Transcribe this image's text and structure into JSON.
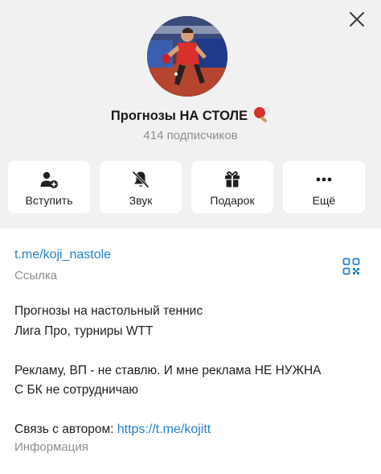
{
  "channel": {
    "title": "Прогнозы НА СТОЛЕ",
    "title_emoji": "🏓",
    "subscribers": "414 подписчиков"
  },
  "actions": [
    {
      "label": "Вступить",
      "icon": "add-user-icon"
    },
    {
      "label": "Звук",
      "icon": "bell-muted-icon"
    },
    {
      "label": "Подарок",
      "icon": "gift-icon"
    },
    {
      "label": "Ещё",
      "icon": "more-icon"
    }
  ],
  "link": {
    "value": "t.me/koji_nastole",
    "label": "Ссылка"
  },
  "description": {
    "line1": "Прогнозы на настольный теннис",
    "line2": "Лига Про, турниры WTT",
    "line3": "Рекламу, ВП - не ставлю. И мне реклама НЕ НУЖНА",
    "line4": "С БК не сотрудничаю",
    "contact_prefix": "Связь с автором: ",
    "contact_link": "https://t.me/kojitt",
    "label": "Информация"
  },
  "colors": {
    "accent_link": "#2481cc",
    "header_bg": "#f1f1f1",
    "muted_text": "#8e8e8e"
  }
}
